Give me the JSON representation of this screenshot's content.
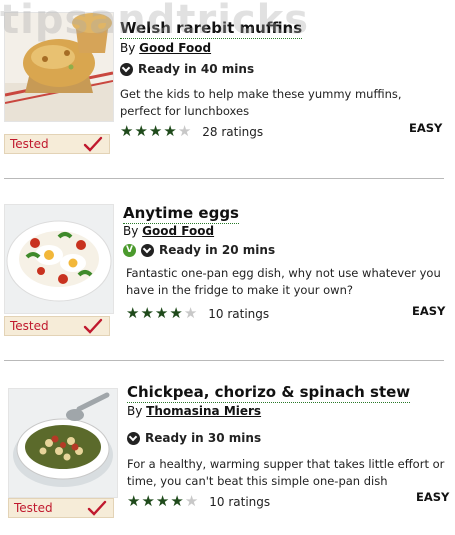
{
  "watermark": "tipsandtricks",
  "recipes": [
    {
      "title": "Welsh rarebit muffins",
      "by_prefix": "By",
      "author": "Good Food",
      "ready": "Ready in 40 mins",
      "vegetarian": false,
      "description": "Get the kids to help make these yummy muffins, perfect for lunchboxes",
      "rating_stars": 4,
      "rating_count": "28 ratings",
      "difficulty": "EASY",
      "tested_label": "Tested"
    },
    {
      "title": "Anytime eggs",
      "by_prefix": "By",
      "author": "Good Food",
      "ready": "Ready in 20 mins",
      "vegetarian": true,
      "veg_badge": "V",
      "description": "Fantastic one-pan egg dish, why not use whatever you have in the fridge to make it your own?",
      "rating_stars": 4,
      "rating_count": "10 ratings",
      "difficulty": "EASY",
      "tested_label": "Tested"
    },
    {
      "title": "Chickpea, chorizo & spinach stew",
      "by_prefix": "By",
      "author": "Thomasina Miers",
      "ready": "Ready in 30 mins",
      "vegetarian": false,
      "description": "For a healthy, warming supper that takes little effort or time, you can't beat this simple one-pan dish",
      "rating_stars": 4,
      "rating_count": "10 ratings",
      "difficulty": "EASY",
      "tested_label": "Tested"
    }
  ],
  "colors": {
    "tested_red": "#c0192e",
    "star_green": "#1f4a1b",
    "veg_green": "#4b9a2d",
    "tested_bg": "#f6ecd8"
  }
}
